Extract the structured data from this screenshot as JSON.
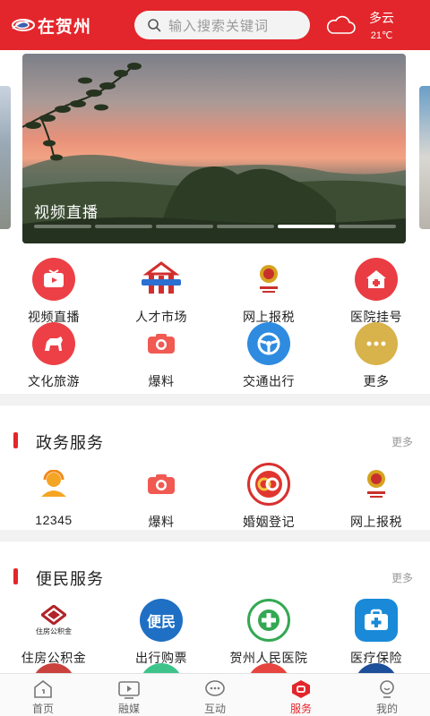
{
  "header": {
    "logo_text": "在贺州",
    "search_placeholder": "输入搜索关键词",
    "weather": {
      "condition": "多云",
      "temperature": "21℃",
      "icon": "cloud-icon"
    }
  },
  "banner": {
    "caption": "视频直播",
    "slide_count": 6,
    "active_slide": 5
  },
  "quick_services": [
    {
      "label": "视频直播",
      "icon": "video-live-icon"
    },
    {
      "label": "人才市场",
      "icon": "talent-market-icon"
    },
    {
      "label": "网上报税",
      "icon": "tax-emblem-icon"
    },
    {
      "label": "医院挂号",
      "icon": "hospital-icon"
    },
    {
      "label": "文化旅游",
      "icon": "travel-icon"
    },
    {
      "label": "爆料",
      "icon": "camera-icon"
    },
    {
      "label": "交通出行",
      "icon": "steering-wheel-icon"
    },
    {
      "label": "更多",
      "icon": "more-icon"
    }
  ],
  "gov_section": {
    "title": "政务服务",
    "more": "更多",
    "items": [
      {
        "label": "12345",
        "icon": "hotline-agent-icon"
      },
      {
        "label": "爆料",
        "icon": "camera-icon"
      },
      {
        "label": "婚姻登记",
        "icon": "marriage-registration-icon"
      },
      {
        "label": "网上报税",
        "icon": "tax-emblem-icon"
      }
    ]
  },
  "life_section": {
    "title": "便民服务",
    "more": "更多",
    "items": [
      {
        "label": "住房公积金",
        "icon": "housing-fund-icon",
        "small_text": "住房公积金"
      },
      {
        "label": "出行购票",
        "icon": "travel-ticket-icon",
        "badge_text": "便民"
      },
      {
        "label": "贺州人民医院",
        "icon": "people-hospital-icon"
      },
      {
        "label": "医疗保险",
        "icon": "medical-insurance-icon"
      }
    ]
  },
  "tabbar": {
    "tabs": [
      {
        "label": "首页",
        "icon": "home-icon"
      },
      {
        "label": "融媒",
        "icon": "tv-icon"
      },
      {
        "label": "互动",
        "icon": "chat-icon"
      },
      {
        "label": "服务",
        "icon": "service-icon",
        "active": true
      },
      {
        "label": "我的",
        "icon": "profile-icon"
      }
    ]
  },
  "colors": {
    "brand": "#e3262b",
    "muted_text": "#999999"
  }
}
